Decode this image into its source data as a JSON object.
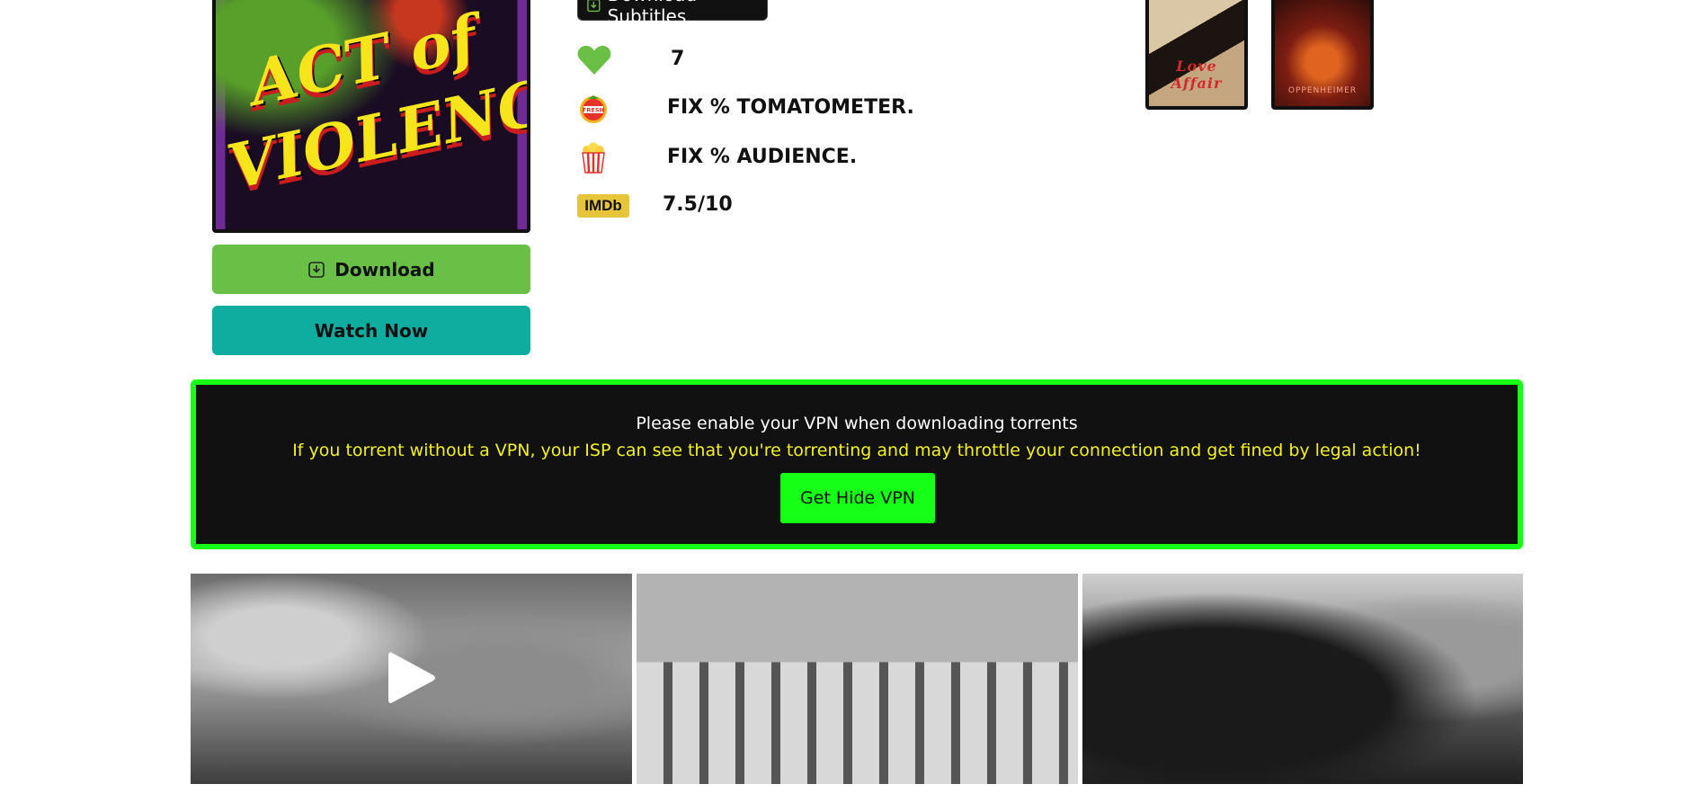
{
  "poster": {
    "title_line1": "ACT of",
    "title_line2": "VIOLENCE"
  },
  "buttons": {
    "download_label": "Download",
    "watch_label": "Watch Now",
    "subtitles_label": "Download Subtitles"
  },
  "ratings": {
    "likes": "7",
    "tomatometer": "FIX % TOMATOMETER.",
    "audience": "FIX % AUDIENCE.",
    "imdb_badge": "IMDb",
    "imdb": "7.5/10"
  },
  "related": [
    {
      "title": "Love Affair",
      "label": "Love Affair"
    },
    {
      "title": "Oppenheimer",
      "label": "OPPENHEIMER"
    }
  ],
  "vpn_notice": {
    "line1": "Please enable your VPN when downloading torrents",
    "line2": "If you torrent without a VPN, your ISP can see that you're torrenting and may throttle your connection and get fined by legal action!",
    "button_label": "Get Hide VPN"
  },
  "icons": {
    "heart": "heart-icon",
    "tomato": "fresh-tomato-icon",
    "popcorn": "popcorn-icon",
    "imdb": "imdb-logo",
    "download": "download-icon",
    "play": "play-icon"
  },
  "colors": {
    "download_btn": "#6ac046",
    "watch_btn": "#0fada0",
    "vpn_border": "#16ff16",
    "vpn_text_highlight": "#f4f11c",
    "heart": "#6ac046"
  }
}
